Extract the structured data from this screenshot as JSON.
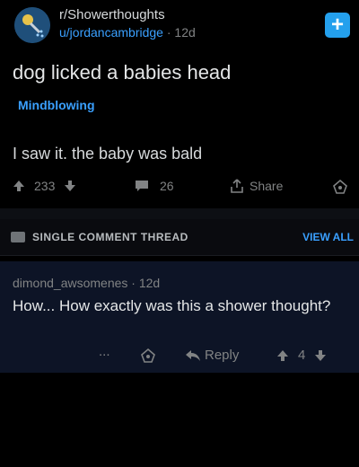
{
  "post": {
    "subreddit": "r/Showerthoughts",
    "author": "u/jordancambridge",
    "age": "12d",
    "title": "dog licked a babies head",
    "flair": "Mindblowing",
    "body": "I saw it. the baby was bald",
    "score": "233",
    "comments": "26",
    "share_label": "Share"
  },
  "thread": {
    "label": "SINGLE COMMENT THREAD",
    "view_all": "VIEW ALL"
  },
  "comment": {
    "author": "dimond_awsomenes",
    "age": "12d",
    "text": "How... How exactly was this a shower thought?",
    "more": "...",
    "reply_label": "Reply",
    "score": "4"
  },
  "colors": {
    "accent": "#3aa0ff",
    "comment_bg": "#0d1426"
  }
}
